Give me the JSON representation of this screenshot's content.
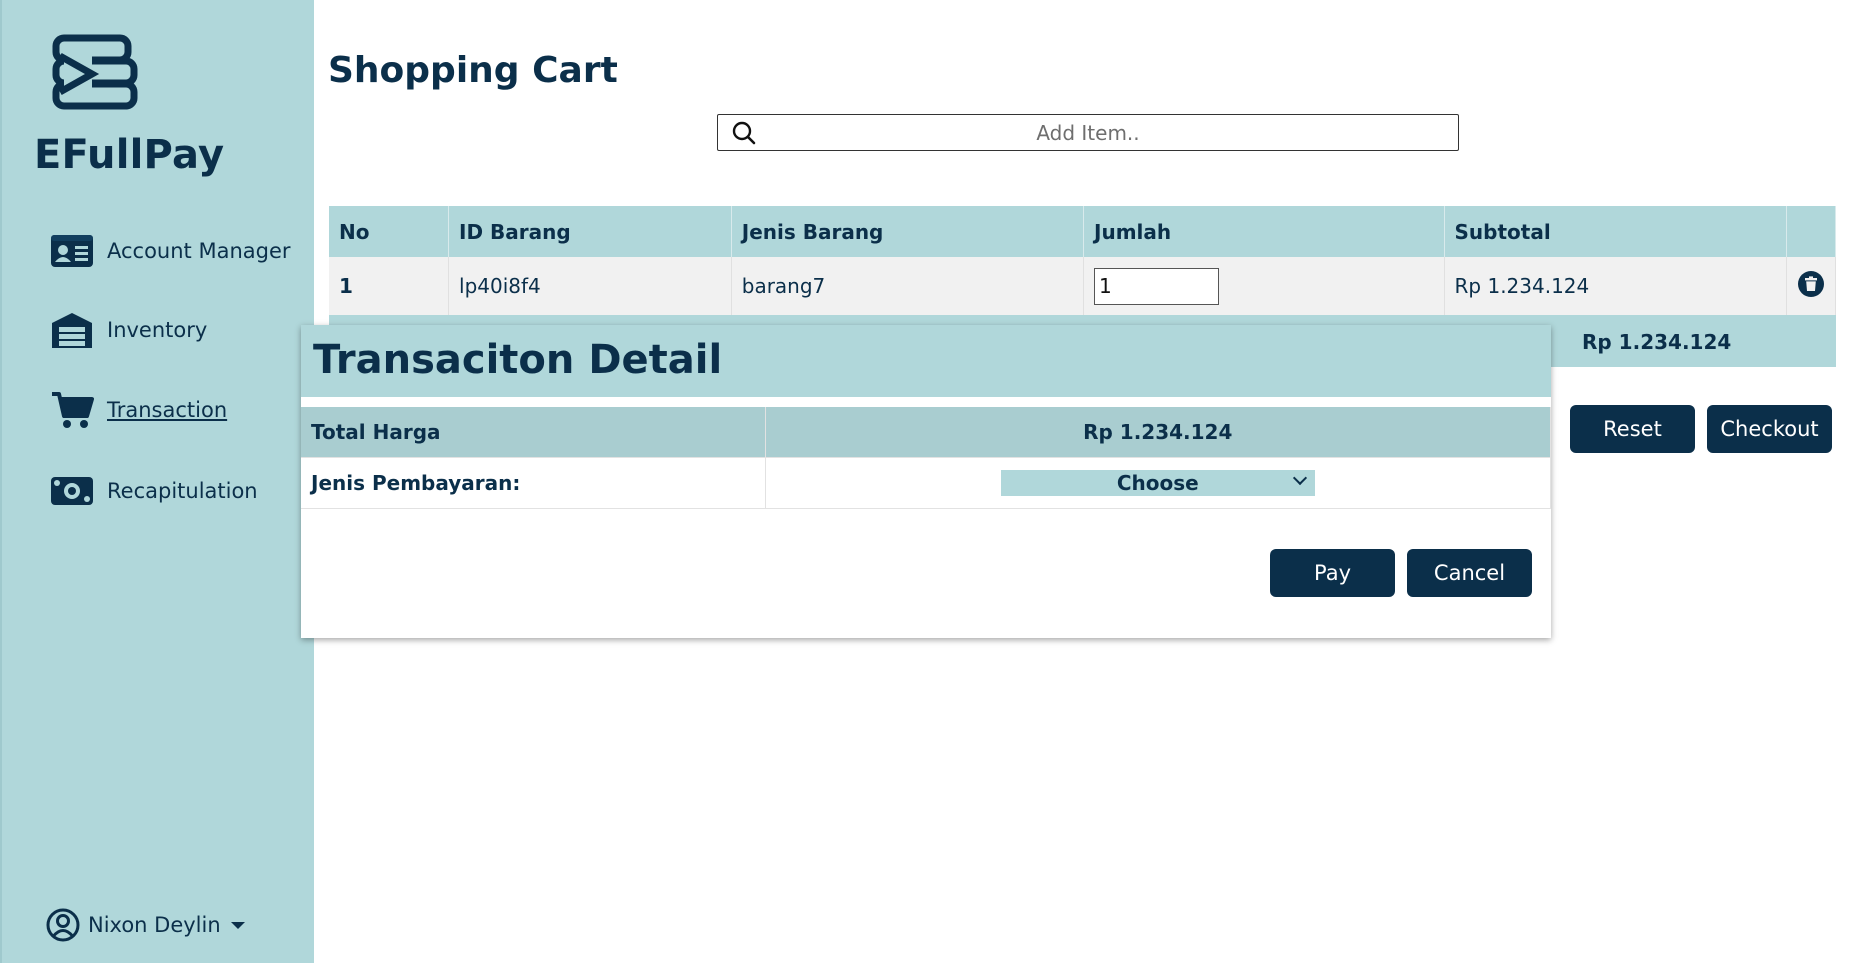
{
  "app": {
    "brand": "EFullPay"
  },
  "sidebar": {
    "items": [
      {
        "label": "Account Manager",
        "icon": "id-card-icon"
      },
      {
        "label": "Inventory",
        "icon": "warehouse-icon"
      },
      {
        "label": "Transaction",
        "icon": "cart-icon",
        "active": true
      },
      {
        "label": "Recapitulation",
        "icon": "money-icon"
      }
    ],
    "user": {
      "name": "Nixon Deylin"
    }
  },
  "main": {
    "title": "Shopping Cart",
    "search": {
      "placeholder": "Add Item.."
    },
    "table": {
      "headers": [
        "No",
        "ID Barang",
        "Jenis Barang",
        "Jumlah",
        "Subtotal"
      ],
      "rows": [
        {
          "no": "1",
          "id": "lp40i8f4",
          "jenis": "barang7",
          "jumlah": "1",
          "subtotal": "Rp 1.234.124"
        }
      ],
      "total": "Rp 1.234.124"
    },
    "buttons": {
      "reset": "Reset",
      "checkout": "Checkout"
    }
  },
  "modal": {
    "title": "Transaciton Detail",
    "total_label": "Total Harga",
    "total_value": "Rp 1.234.124",
    "payment_label": "Jenis Pembayaran:",
    "payment_selected": "Choose",
    "buttons": {
      "pay": "Pay",
      "cancel": "Cancel"
    }
  },
  "colors": {
    "accent": "#b0d7da",
    "primary": "#0b2f4a"
  }
}
